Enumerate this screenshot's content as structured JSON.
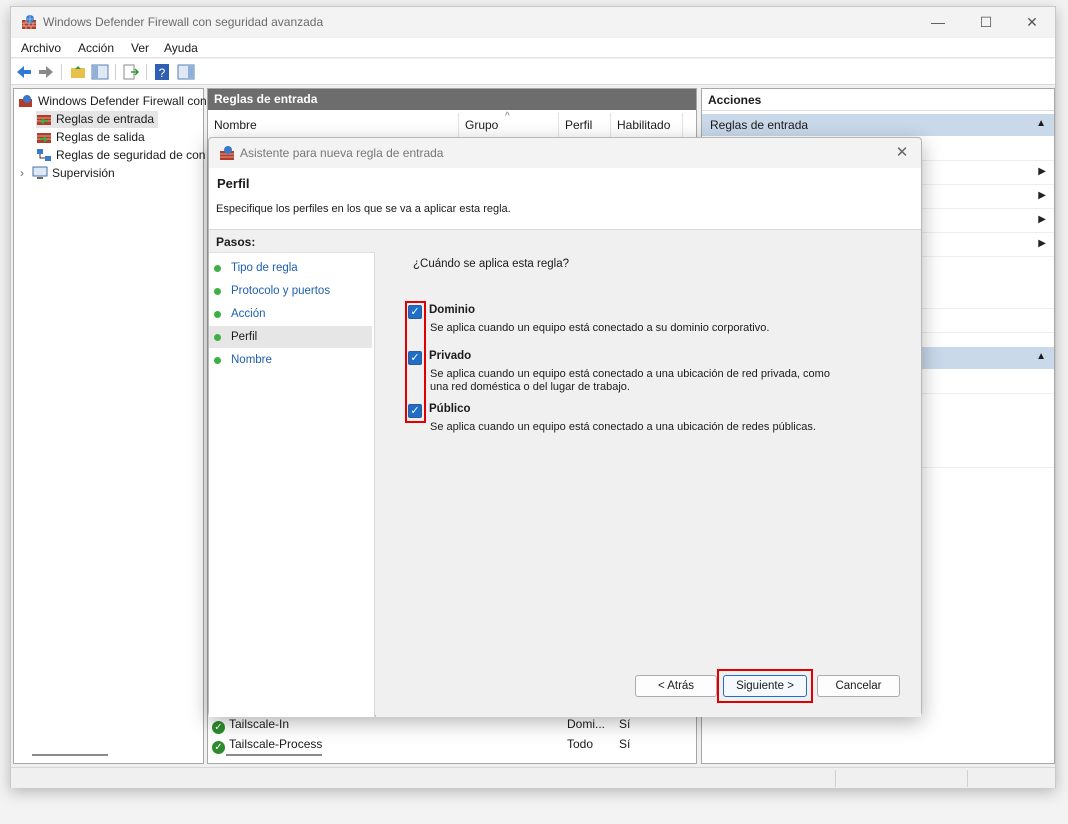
{
  "window": {
    "title": "Windows Defender Firewall con seguridad avanzada"
  },
  "menu": [
    "Archivo",
    "Acción",
    "Ver",
    "Ayuda"
  ],
  "tree": {
    "root": "Windows Defender Firewall con",
    "items": [
      "Reglas de entrada",
      "Reglas de salida",
      "Reglas de seguridad de con",
      "Supervisión"
    ]
  },
  "center": {
    "header": "Reglas de entrada",
    "columns": [
      "Nombre",
      "Grupo",
      "Perfil",
      "Habilitado"
    ],
    "rows": [
      {
        "name": "Tailscale-In",
        "profile": "Domi...",
        "enabled": "Sí"
      },
      {
        "name": "Tailscale-Process",
        "profile": "Todo",
        "enabled": "Sí"
      }
    ]
  },
  "actions": {
    "header": "Acciones",
    "section": "Reglas de entrada"
  },
  "dialog": {
    "title": "Asistente para nueva regla de entrada",
    "heading": "Perfil",
    "subheading": "Especifique los perfiles en los que se va a aplicar esta regla.",
    "steps_title": "Pasos:",
    "steps": [
      "Tipo de regla",
      "Protocolo y puertos",
      "Acción",
      "Perfil",
      "Nombre"
    ],
    "question": "¿Cuándo se aplica esta regla?",
    "options": [
      {
        "label": "Dominio",
        "checked": true,
        "desc1": "Se aplica cuando un equipo está conectado a su dominio corporativo.",
        "desc2": ""
      },
      {
        "label": "Privado",
        "checked": true,
        "desc1": "Se aplica cuando un equipo está conectado a una ubicación de red privada, como",
        "desc2": "una red doméstica o del lugar de trabajo."
      },
      {
        "label": "Público",
        "checked": true,
        "desc1": "Se aplica cuando un equipo está conectado a una ubicación de redes públicas.",
        "desc2": ""
      }
    ],
    "buttons": {
      "back": "< Atrás",
      "next": "Siguiente >",
      "cancel": "Cancelar"
    }
  }
}
